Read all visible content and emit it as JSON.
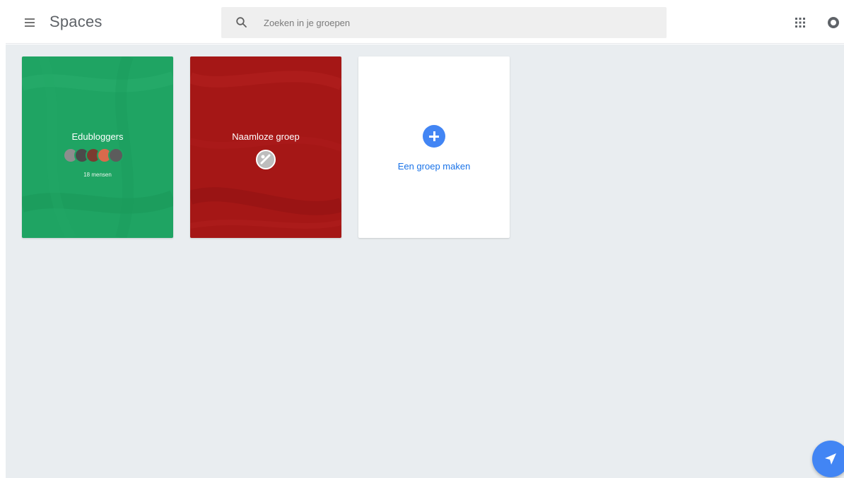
{
  "header": {
    "app_title": "Spaces",
    "search_placeholder": "Zoeken in je groepen",
    "menu_icon": "hamburger-menu-icon",
    "apps_icon": "apps-grid-icon",
    "account_icon": "account-avatar-icon"
  },
  "groups": [
    {
      "name": "Edubloggers",
      "member_count": "18 mensen",
      "color": "#1fa463"
    },
    {
      "name": "Naamloze groep",
      "color": "#a51716"
    }
  ],
  "create_card": {
    "label": "Een groep maken",
    "icon": "add-circle-icon",
    "accent": "#4285f4"
  },
  "fab": {
    "icon": "send-icon",
    "color": "#4285f4"
  }
}
